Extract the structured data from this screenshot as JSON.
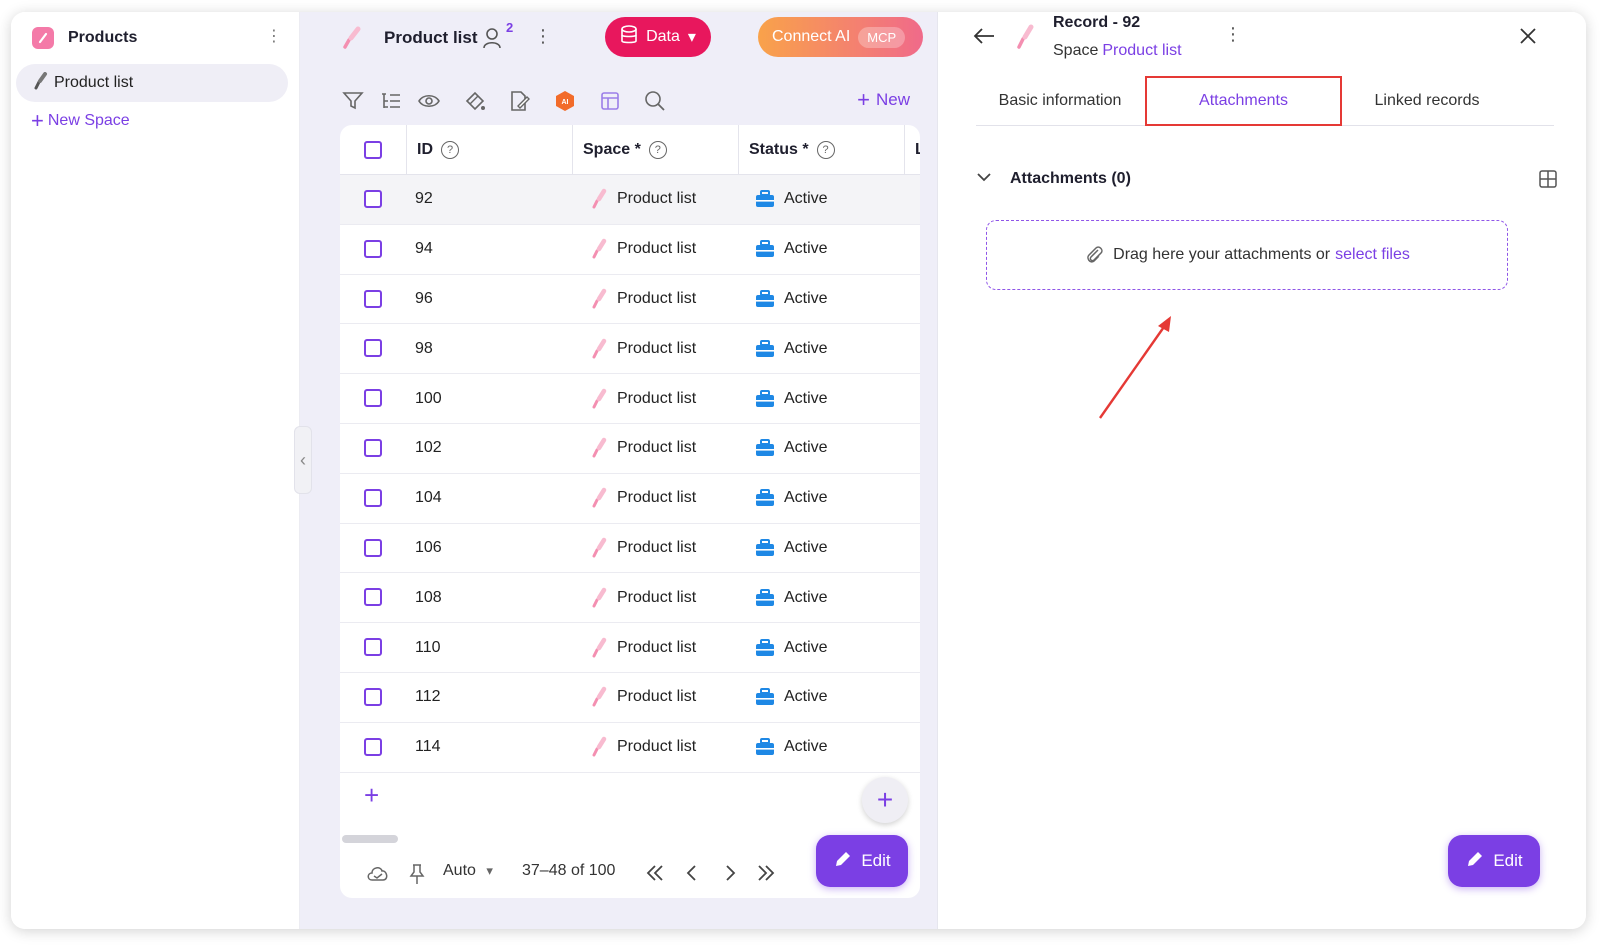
{
  "sidebar": {
    "title": "Products",
    "items": [
      {
        "label": "Product list"
      }
    ],
    "new_space_label": "New Space"
  },
  "topbar": {
    "title": "Product list",
    "user_count": "2",
    "data_button": "Data",
    "connect_button": "Connect AI",
    "mcp_badge": "MCP"
  },
  "toolbar": {
    "icons": [
      "filter-icon",
      "sort-icon",
      "eye-icon",
      "paint-icon",
      "edit-form-icon",
      "ai-icon",
      "layout-icon",
      "search-icon"
    ],
    "new_label": "New"
  },
  "table": {
    "columns": [
      {
        "label": "ID"
      },
      {
        "label": "Space *"
      },
      {
        "label": "Status *"
      },
      {
        "label": "L"
      }
    ],
    "rows": [
      {
        "id": "92",
        "space": "Product list",
        "status": "Active"
      },
      {
        "id": "94",
        "space": "Product list",
        "status": "Active"
      },
      {
        "id": "96",
        "space": "Product list",
        "status": "Active"
      },
      {
        "id": "98",
        "space": "Product list",
        "status": "Active"
      },
      {
        "id": "100",
        "space": "Product list",
        "status": "Active"
      },
      {
        "id": "102",
        "space": "Product list",
        "status": "Active"
      },
      {
        "id": "104",
        "space": "Product list",
        "status": "Active"
      },
      {
        "id": "106",
        "space": "Product list",
        "status": "Active"
      },
      {
        "id": "108",
        "space": "Product list",
        "status": "Active"
      },
      {
        "id": "110",
        "space": "Product list",
        "status": "Active"
      },
      {
        "id": "112",
        "space": "Product list",
        "status": "Active"
      },
      {
        "id": "114",
        "space": "Product list",
        "status": "Active"
      }
    ]
  },
  "pager": {
    "mode": "Auto",
    "range": "37–48 of 100"
  },
  "edit_label": "Edit",
  "panel": {
    "title": "Record - 92",
    "space_label": "Space",
    "space_link": "Product list",
    "tabs": [
      {
        "label": "Basic information"
      },
      {
        "label": "Attachments"
      },
      {
        "label": "Linked records"
      }
    ],
    "section_title": "Attachments (0)",
    "dropzone_text": "Drag here your attachments or",
    "dropzone_link": "select files",
    "edit_label": "Edit"
  },
  "colors": {
    "accent": "#7b3fe4",
    "data_button": "#e8175d",
    "highlight": "#e53935",
    "status_icon": "#1e88e5"
  }
}
